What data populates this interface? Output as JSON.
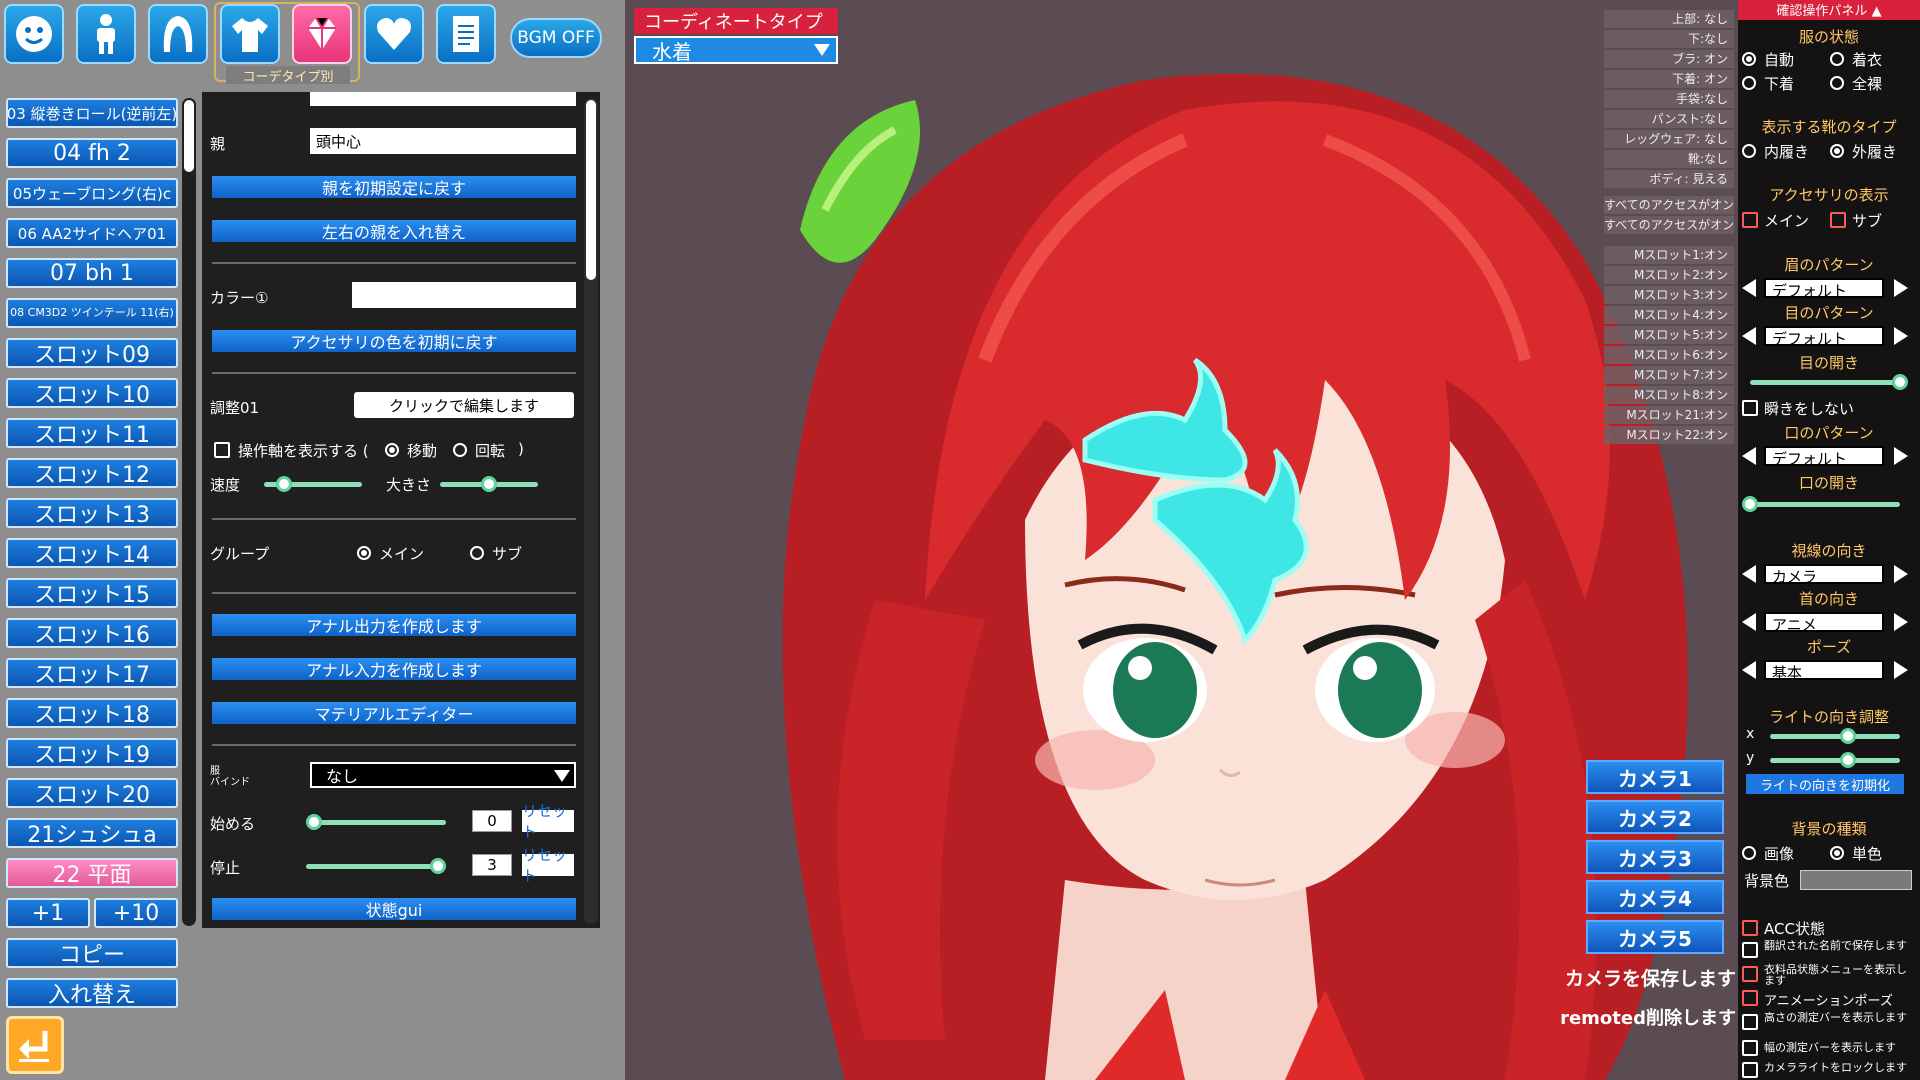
{
  "top_icons": [
    {
      "name": "face-icon"
    },
    {
      "name": "body-icon"
    },
    {
      "name": "hair-icon"
    },
    {
      "name": "clothes-icon"
    },
    {
      "name": "accessory-icon"
    },
    {
      "name": "heart-icon"
    },
    {
      "name": "document-icon"
    }
  ],
  "top_frame_label": "コーデタイプ別",
  "bgm_label": "BGM OFF",
  "slots": [
    "03 縦巻きロール(逆前左)",
    "04 fh 2",
    "05ウェーブロング(右)c",
    "06 AA2サイドヘア01",
    "07 bh 1",
    "08 CM3D2 ツインテール 11(右)",
    "スロット09",
    "スロット10",
    "スロット11",
    "スロット12",
    "スロット13",
    "スロット14",
    "スロット15",
    "スロット16",
    "スロット17",
    "スロット18",
    "スロット19",
    "スロット20",
    "21シュシュa",
    "22 平面"
  ],
  "add_one": "+1",
  "add_ten": "+10",
  "copy_label": "コピー",
  "swap_label": "入れ替え",
  "panel": {
    "parent_label": "親",
    "parent_value": "頭中心",
    "reset_parent": "親を初期設定に戻す",
    "swap_parent": "左右の親を入れ替え",
    "color_label": "カラー①",
    "reset_color": "アクセサリの色を初期に戻す",
    "adjust_label": "調整01",
    "adjust_button": "クリックで編集します",
    "show_axis": "操作軸を表示する (",
    "move": "移動",
    "rotate": "回転",
    "paren_close": ")",
    "speed": "速度",
    "size": "大きさ",
    "speed_value": 0.2,
    "size_value": 0.5,
    "group": "グループ",
    "main": "メイン",
    "sub": "サブ",
    "anal_output": "アナル出力を作成します",
    "anal_input": "アナル入力を作成します",
    "material_editor": "マテリアルエディター",
    "bind_label_1": "服",
    "bind_label_2": "バインド",
    "bind_value": "なし",
    "start_label": "始める",
    "start_value": "0",
    "stop_label": "停止",
    "stop_value": "3",
    "reset": "リセット",
    "state_gui": "状態gui"
  },
  "coordinate": {
    "label": "コーディネートタイプ",
    "value": "水着"
  },
  "status_list": [
    "上部: なし",
    "下:なし",
    "ブラ: オン",
    "下着: オン",
    "手袋:なし",
    "パンスト:なし",
    "レッグウェア: なし",
    "靴:なし",
    "ボディ: 見える",
    "すべてのアクセスがオン",
    "すべてのアクセスがオン",
    "Mスロット1:オン",
    "Mスロット2:オン",
    "Mスロット3:オン",
    "Mスロット4:オン",
    "Mスロット5:オン",
    "Mスロット6:オン",
    "Mスロット7:オン",
    "Mスロット8:オン",
    "Mスロット21:オン",
    "Mスロット22:オン"
  ],
  "cameras": [
    "カメラ1",
    "カメラ2",
    "カメラ3",
    "カメラ4",
    "カメラ5"
  ],
  "save_camera": "カメラを保存します",
  "remoted_delete": "remoted削除します",
  "confirm": {
    "title": "確認操作パネル",
    "clothes_state": "服の状態",
    "auto": "自動",
    "wearing": "着衣",
    "underwear": "下着",
    "nude": "全裸",
    "shoe_type": "表示する靴のタイプ",
    "indoor": "内履き",
    "outdoor": "外履き",
    "acc_display": "アクセサリの表示",
    "acc_main": "メイン",
    "acc_sub": "サブ",
    "brow_pattern": "眉のパターン",
    "brow_value": "デフォルト",
    "eye_pattern": "目のパターン",
    "eye_value": "デフォルト",
    "eye_open": "目の開き",
    "eye_open_value": 1.0,
    "no_blink": "瞬きをしない",
    "mouth_pattern": "口のパターン",
    "mouth_value": "デフォルト",
    "mouth_open": "口の開き",
    "mouth_open_value": 0.0,
    "gaze": "視線の向き",
    "gaze_value": "カメラ",
    "neck": "首の向き",
    "neck_value": "アニメ",
    "pose": "ポーズ",
    "pose_value": "基本",
    "light_adjust": "ライトの向き調整",
    "x": "x",
    "y": "y",
    "light_x": 0.6,
    "light_y": 0.6,
    "light_reset": "ライトの向きを初期化",
    "bg_type": "背景の種類",
    "image": "画像",
    "solid": "単色",
    "bg_color": "背景色",
    "acc_state": "ACC状態",
    "opt1": "翻訳された名前で保存します",
    "opt2": "衣料品状態メニューを表示します",
    "opt3": "アニメーションポーズ",
    "opt4": "高さの測定バーを表示します",
    "opt5": "幅の測定バーを表示します",
    "opt6": "カメラライトをロックします"
  },
  "colors": {
    "accent_blue": "#1f8ae4",
    "accent_red": "#d8213c",
    "accent_pink": "#e8357a",
    "hair_red": "#d92a2e",
    "background": "#5b4b52"
  }
}
